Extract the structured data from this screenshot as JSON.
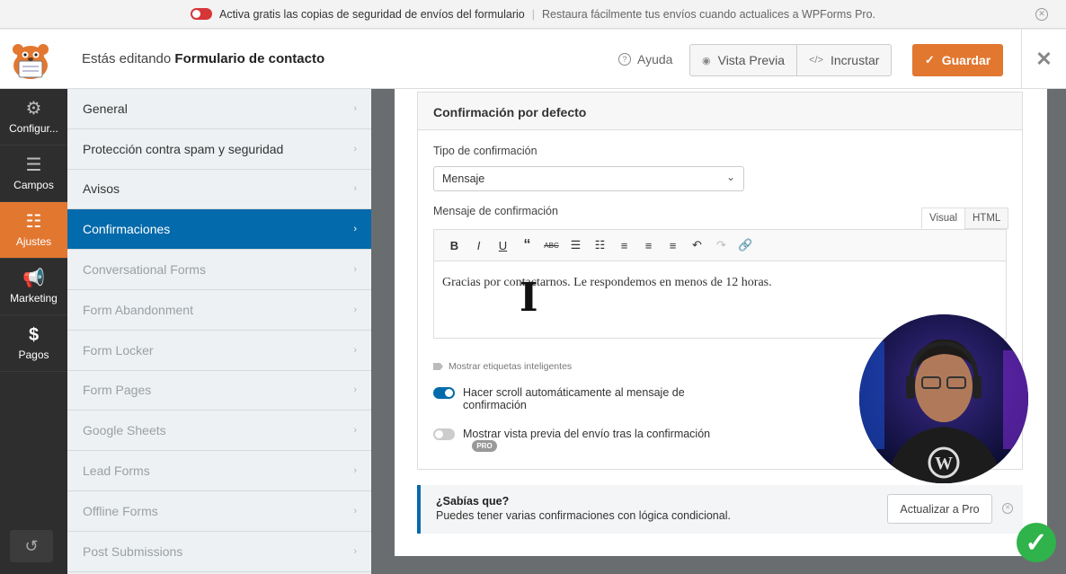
{
  "notice": {
    "message": "Activa gratis las copias de seguridad de envíos del formulario",
    "secondary": "Restaura fácilmente tus envíos cuando actualices a WPForms Pro."
  },
  "header": {
    "editing_prefix": "Estás editando",
    "form_name": "Formulario de contacto",
    "help": "Ayuda",
    "preview": "Vista Previa",
    "embed": "Incrustar",
    "save": "Guardar"
  },
  "iconbar": {
    "items": [
      {
        "label": "Configur...",
        "icon": "gear-icon"
      },
      {
        "label": "Campos",
        "icon": "fields-icon"
      },
      {
        "label": "Ajustes",
        "icon": "sliders-icon"
      },
      {
        "label": "Marketing",
        "icon": "megaphone-icon"
      },
      {
        "label": "Pagos",
        "icon": "dollar-icon"
      }
    ],
    "active_index": 2
  },
  "settings_panel": {
    "items": [
      "General",
      "Protección contra spam y seguridad",
      "Avisos",
      "Confirmaciones",
      "Conversational Forms",
      "Form Abandonment",
      "Form Locker",
      "Form Pages",
      "Google Sheets",
      "Lead Forms",
      "Offline Forms",
      "Post Submissions"
    ],
    "active": "Confirmaciones"
  },
  "confirmation": {
    "title": "Confirmación por defecto",
    "type_label": "Tipo de confirmación",
    "type_value": "Mensaje",
    "message_label": "Mensaje de confirmación",
    "tab_visual": "Visual",
    "tab_html": "HTML",
    "message_text": "Gracias por contactarnos. Le respondemos en menos de 12 horas.",
    "smart_tags": "Mostrar etiquetas inteligentes",
    "scroll_toggle_label": "Hacer scroll automáticamente al mensaje de confirmación",
    "scroll_toggle_on": true,
    "preview_toggle_label": "Mostrar vista previa del envío tras la confirmación",
    "preview_toggle_on": false,
    "pro_badge": "PRO"
  },
  "tip": {
    "title": "¿Sabías que?",
    "text": "Puedes tener varias confirmaciones con lógica condicional.",
    "button": "Actualizar a Pro"
  },
  "colors": {
    "accent_orange": "#e27730",
    "active_blue": "#036aab",
    "success_green": "#2fb34a"
  }
}
